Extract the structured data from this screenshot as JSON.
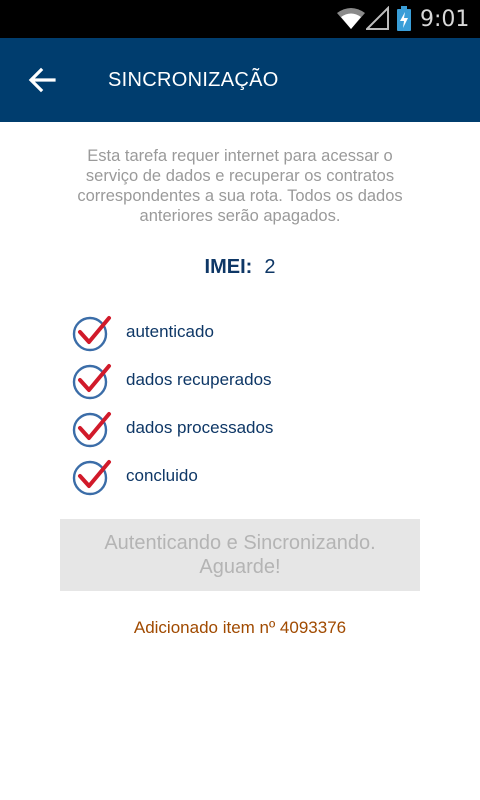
{
  "status_bar": {
    "time": "9:01",
    "icons": [
      "wifi-icon",
      "signal-icon",
      "battery-charging-icon"
    ]
  },
  "app_bar": {
    "title": "SINCRONIZAÇÃO",
    "back_icon": "arrow-left-icon",
    "color": "#003d6e"
  },
  "intro_text": "Esta tarefa requer internet para acessar o serviço de dados e recuperar os contratos correspondentes a sua rota. Todos os dados anteriores serão apagados.",
  "imei": {
    "label": "IMEI:",
    "value": "2"
  },
  "steps": [
    {
      "label": "autenticado",
      "done": true
    },
    {
      "label": "dados recuperados",
      "done": true
    },
    {
      "label": "dados processados",
      "done": true
    },
    {
      "label": "concluido",
      "done": true
    }
  ],
  "status_button": {
    "line1": "Autenticando e Sincronizando.",
    "line2": "Aguarde!"
  },
  "progress_message": "Adicionado item nº 4093376",
  "colors": {
    "check_red": "#d11a2a",
    "circle_blue": "#3b6da8",
    "text_navy": "#0e3766",
    "message_orange": "#a04a00"
  }
}
